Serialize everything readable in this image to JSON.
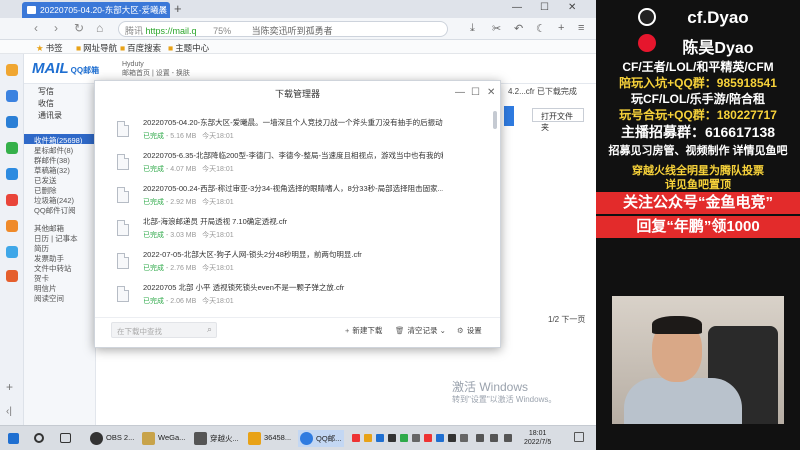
{
  "browser": {
    "tab_title": "20220705-04.20-东部大区-爱曦晨",
    "url_prefix": "腾讯",
    "url": "https://mail.q",
    "zoom": "75%",
    "url_hint": "当陈奕迅听到孤勇者",
    "bookmarks": [
      "书签",
      "网址导航",
      "百度搜索",
      "主题中心"
    ]
  },
  "mail": {
    "logo": "MAIL",
    "logo_sub": "QQ邮箱",
    "user_name": "Hyduty",
    "user_links": "邮箱首页 | 设置 - 换肤",
    "nav_main": [
      "写信",
      "收信",
      "通讯录"
    ],
    "nav_folders": [
      "收件箱(25698)",
      "星标邮件(8)",
      "群邮件(38)",
      "草稿箱(32)",
      "已发送",
      "已删除",
      "垃圾箱(242)",
      "QQ邮件订阅"
    ],
    "nav_more": [
      "其他邮箱",
      "日历 | 记事本",
      "简历",
      "发票助手",
      "文件中转站",
      "贺卡",
      "明信片",
      "阅读空间"
    ],
    "right_filename": "4.2...cfr 已下载完成",
    "open_folder": "打开文件夹",
    "pager": "1/2 下一页"
  },
  "download_manager": {
    "title": "下载管理器",
    "items": [
      {
        "name": "20220705-04.20-东部大区-爱曦晨。一墙深且个人竞技刀战一个斧头重刀没有抽手的后振动作...",
        "status": "已完成",
        "size": "5.16 MB",
        "time": "今天18:01"
      },
      {
        "name": "20220705-6.35-北部降临200型-李德门、李德今-整局-当速度且相视点，游戏当中也有我的精彩...",
        "status": "已完成",
        "size": "4.07 MB",
        "time": "今天18:01"
      },
      {
        "name": "20220705-00.24-西部-称过审亚-3分34-视角选择的眼睛嗜人，8分33秒-局部选择阻击固家...",
        "status": "已完成",
        "size": "2.92 MB",
        "time": "今天18:01"
      },
      {
        "name": "北部-海浪邮递员 开局透视 7.10确定透视.cfr",
        "status": "已完成",
        "size": "3.03 MB",
        "time": "今天18:01"
      },
      {
        "name": "2022-07-05-北部大区-狗子人网-锁头2分48秒明显，前两句明显.cfr",
        "status": "已完成",
        "size": "2.76 MB",
        "time": "今天18:01"
      },
      {
        "name": "20220705 北部 小平 透视锁死锁头even不是一颗子弹之放.cfr",
        "status": "已完成",
        "size": "2.06 MB",
        "time": "今天18:01"
      }
    ],
    "search_placeholder": "在下载中查找",
    "new_download": "新建下载",
    "clear_records": "清空记录",
    "settings": "设置"
  },
  "watermark": {
    "line1": "激活 Windows",
    "line2": "转到\"设置\"以激活 Windows。"
  },
  "taskbar": {
    "apps": [
      "OBS 2...",
      "WeGa...",
      "穿越火...",
      "36458...",
      "QQ邮..."
    ],
    "time": "18:01",
    "date": "2022/7/5"
  },
  "overlay": {
    "line_douyin": "cf.Dyao",
    "line_weibo": "陈昊Dyao",
    "line1": "CF/王者/LOL/和平精英/CFM",
    "line2": "陪玩入坑+QQ群：985918541",
    "line3": "玩CF/LOL/乐手游/陪合租",
    "line4": "玩号合玩+QQ群：180227717",
    "line5": "主播招募群：616617138",
    "line6": "招募见习房管、视频制作 详情见鱼吧",
    "line7": "穿越火线全明星为腾队投票",
    "line8": "详见鱼吧置顶",
    "line9": "关注公众号“金鱼电竞”",
    "line10": "回复“年鹏”领1000"
  },
  "colors": {
    "tab_blue": "#3b78d8",
    "success_green": "#2faa4a",
    "overlay_yellow": "#f7d23a",
    "overlay_red": "#e32b2b"
  }
}
